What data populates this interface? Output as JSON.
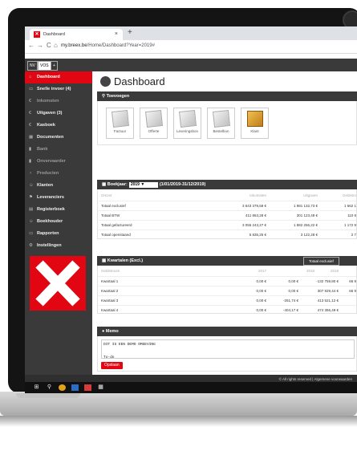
{
  "browser": {
    "tab_title": "Dashboard",
    "tab_close": "×",
    "new_tab": "+",
    "url_host": "my.breex.be",
    "url_path": "/Home/Dashboard?Year=2019#",
    "back": "←",
    "forward": "→",
    "reload": "C",
    "home": "⌂"
  },
  "orgs": [
    "NV",
    "VOS",
    "+"
  ],
  "sidebar": {
    "items": [
      {
        "label": "Dashboard",
        "icon": "⌂"
      },
      {
        "label": "Snelle invoer (4)",
        "icon": "▭"
      },
      {
        "label": "Inkomsten",
        "icon": "€"
      },
      {
        "label": "Uitgaven (3)",
        "icon": "€"
      },
      {
        "label": "Kasboek",
        "icon": "€"
      },
      {
        "label": "Documenten",
        "icon": "▦"
      },
      {
        "label": "Bank",
        "icon": "▮"
      },
      {
        "label": "Onvervaarder",
        "icon": "▮"
      },
      {
        "label": "Producten",
        "icon": "♀"
      },
      {
        "label": "Klanten",
        "icon": "☺"
      },
      {
        "label": "Leveranciers",
        "icon": "⚑"
      },
      {
        "label": "Registerboek",
        "icon": "▤"
      },
      {
        "label": "Boekhouder",
        "icon": "☺"
      },
      {
        "label": "Rapporten",
        "icon": "▭"
      },
      {
        "label": "Instellingen",
        "icon": "⚙"
      }
    ]
  },
  "page": {
    "title": "Dashboard"
  },
  "toevoegen": {
    "title": "Toevoegen",
    "tiles": [
      "Factuur",
      "Offerte",
      "Leveringsbon",
      "Bestelbon",
      "Klant"
    ]
  },
  "boekjaar": {
    "title": "Boekjaar:",
    "year": "2019",
    "range": "(1/01/2019-31/12/2019)",
    "headers": [
      "Omzet",
      "Inkomsten",
      "Uitgaven",
      "Geldstro"
    ],
    "rows": [
      [
        "Totaal exclusief",
        "3 643 379,58 €",
        "1 981 132,73 €",
        "1 662 1"
      ],
      [
        "Totaal BTW",
        "411 863,28 €",
        "301 123,49 €",
        "110 8"
      ],
      [
        "Totaal gefactureerd",
        "3 055 243,27 €",
        "1 882 256,22 €",
        "1 172 9"
      ],
      [
        "Totaal openstaand",
        "5 835,25 €",
        "3 122,28 €",
        "2 7"
      ]
    ]
  },
  "kwartalen": {
    "title": "Kwartalen (Excl.)",
    "toggle": "Totaal exclusief",
    "headers": [
      "Geldstroom",
      "2017",
      "2018",
      "2019"
    ],
    "rows": [
      [
        "Kwartaal 1",
        "0,00 €",
        "0,00 €",
        "-132 759,80 €",
        "66 8"
      ],
      [
        "Kwartaal 2",
        "0,00 €",
        "0,00 €",
        "307 929,44 €",
        "66 9"
      ],
      [
        "Kwartaal 3",
        "0,00 €",
        "-251,74 €",
        "413 521,12 €",
        ""
      ],
      [
        "Kwartaal 4",
        "0,00 €",
        "-404,17 €",
        "474 356,49 €",
        ""
      ]
    ]
  },
  "memo": {
    "title": "Memo",
    "text": "DIT IS EEN DEMO OMGEVING\n\nTo-do",
    "save": "Opslaan"
  },
  "footer": "© All rights reserved | Algemene voorwaarden"
}
